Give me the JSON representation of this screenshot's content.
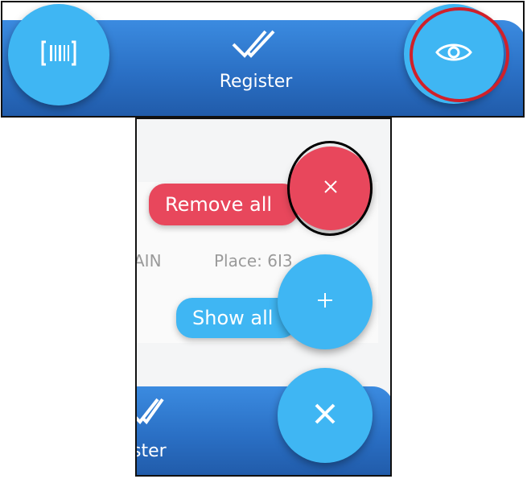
{
  "top_panel": {
    "register_label": "Register",
    "icons": {
      "scan": "barcode-scan-icon",
      "register": "double-check-icon",
      "visibility": "eye-icon"
    }
  },
  "bottom_panel": {
    "remove_all_label": "Remove all",
    "show_all_label": "Show all",
    "partial_left_text": "AIN",
    "place_text": "Place: 6I3",
    "bottom_register_partial": "ster",
    "icons": {
      "remove_fab": "close-icon",
      "add_fab": "plus-icon",
      "main_fab": "close-icon",
      "register": "double-check-icon"
    }
  },
  "colors": {
    "fab_blue": "#3fb6f3",
    "remove_red": "#e8475c",
    "bar_blue": "#2a6fc4",
    "highlight_red_ring": "#d0202a",
    "highlight_black_ring": "#000000"
  }
}
